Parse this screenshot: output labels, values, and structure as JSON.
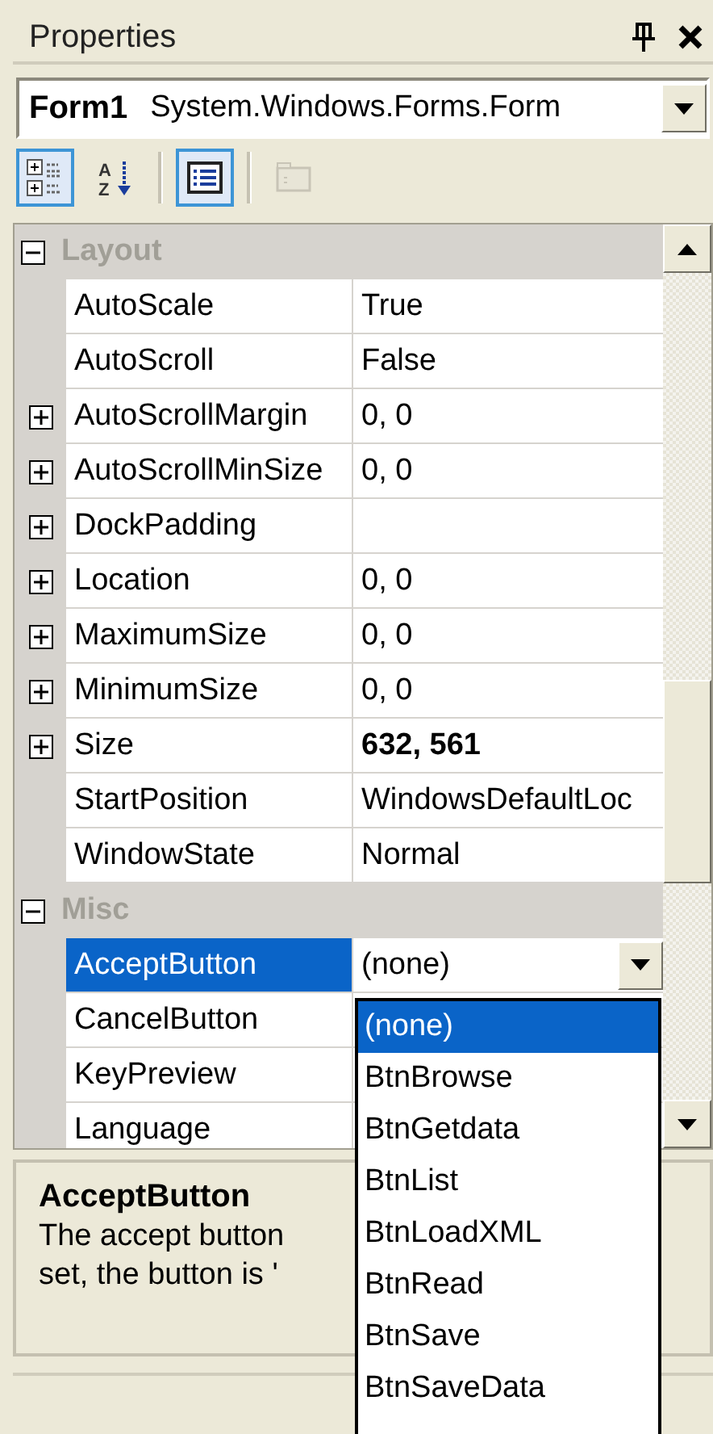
{
  "panel": {
    "title": "Properties"
  },
  "object_selector": {
    "name": "Form1",
    "type": "System.Windows.Forms.Form"
  },
  "toolbar": [
    {
      "kind": "categorized",
      "selected": true,
      "disabled": false
    },
    {
      "kind": "alphabetical",
      "selected": false,
      "disabled": false,
      "glyphs": [
        "A",
        "Z"
      ]
    },
    {
      "kind": "properties",
      "selected": true,
      "disabled": false
    },
    {
      "kind": "pages",
      "selected": false,
      "disabled": true
    }
  ],
  "categories": [
    {
      "name": "Layout",
      "expanded": true,
      "properties": [
        {
          "name": "AutoScale",
          "value": "True",
          "expandable": false,
          "modified": false,
          "selected": false
        },
        {
          "name": "AutoScroll",
          "value": "False",
          "expandable": false,
          "modified": false,
          "selected": false
        },
        {
          "name": "AutoScrollMargin",
          "value": "0, 0",
          "expandable": true,
          "modified": false,
          "selected": false
        },
        {
          "name": "AutoScrollMinSize",
          "value": "0, 0",
          "expandable": true,
          "modified": false,
          "selected": false
        },
        {
          "name": "DockPadding",
          "expandable": true,
          "selected": false
        },
        {
          "name": "Location",
          "value": "0, 0",
          "expandable": true,
          "modified": false,
          "selected": false
        },
        {
          "name": "MaximumSize",
          "value": "0, 0",
          "expandable": true,
          "modified": false,
          "selected": false
        },
        {
          "name": "MinimumSize",
          "value": "0, 0",
          "expandable": true,
          "modified": false,
          "selected": false
        },
        {
          "name": "Size",
          "value": "632, 561",
          "expandable": true,
          "modified": true,
          "selected": false
        },
        {
          "name": "StartPosition",
          "value": "WindowsDefaultLoc",
          "expandable": false,
          "modified": false,
          "selected": false
        },
        {
          "name": "WindowState",
          "value": "Normal",
          "expandable": false,
          "modified": false,
          "selected": false
        }
      ]
    },
    {
      "name": "Misc",
      "expanded": true,
      "properties": [
        {
          "name": "AcceptButton",
          "value": "(none)",
          "expandable": false,
          "modified": false,
          "selected": true
        },
        {
          "name": "CancelButton",
          "expandable": false,
          "selected": false
        },
        {
          "name": "KeyPreview",
          "expandable": false,
          "selected": false
        },
        {
          "name": "Language",
          "expandable": false,
          "selected": false
        }
      ]
    }
  ],
  "dropdown": {
    "items": [
      {
        "label": "(none)",
        "selected": true
      },
      {
        "label": "BtnBrowse",
        "selected": false
      },
      {
        "label": "BtnGetdata",
        "selected": false
      },
      {
        "label": "BtnList",
        "selected": false
      },
      {
        "label": "BtnLoadXML",
        "selected": false
      },
      {
        "label": "BtnRead",
        "selected": false
      },
      {
        "label": "BtnSave",
        "selected": false
      },
      {
        "label": "BtnSaveData",
        "selected": false
      }
    ]
  },
  "description": {
    "title": "AcceptButton",
    "lines": [
      "The accept button",
      "set, the button is '"
    ]
  }
}
